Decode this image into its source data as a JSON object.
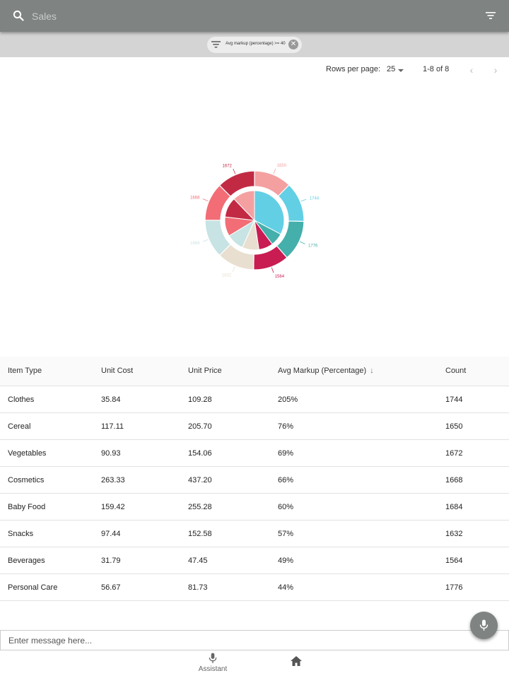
{
  "search": {
    "placeholder": "Sales"
  },
  "filter_chip": {
    "label": "Avg markup (percentage) >= 40"
  },
  "pagination": {
    "rows_per_page_label": "Rows per page:",
    "rows_per_page_value": "25",
    "range_label": "1-8 of 8"
  },
  "table": {
    "columns": [
      "Item Type",
      "Unit Cost",
      "Unit Price",
      "Avg Markup (Percentage)",
      "Count"
    ],
    "rows": [
      [
        "Clothes",
        "35.84",
        "109.28",
        "205%",
        "1744"
      ],
      [
        "Cereal",
        "117.11",
        "205.70",
        "76%",
        "1650"
      ],
      [
        "Vegetables",
        "90.93",
        "154.06",
        "69%",
        "1672"
      ],
      [
        "Cosmetics",
        "263.33",
        "437.20",
        "66%",
        "1668"
      ],
      [
        "Baby Food",
        "159.42",
        "255.28",
        "60%",
        "1684"
      ],
      [
        "Snacks",
        "97.44",
        "152.58",
        "57%",
        "1632"
      ],
      [
        "Beverages",
        "31.79",
        "47.45",
        "49%",
        "1564"
      ],
      [
        "Personal Care",
        "56.67",
        "81.73",
        "44%",
        "1776"
      ]
    ]
  },
  "chart_data": {
    "type": "pie",
    "outer_ring": {
      "categories": [
        "Cereal",
        "Clothes",
        "Personal Care",
        "Beverages",
        "Snacks",
        "Baby Food",
        "Cosmetics",
        "Vegetables"
      ],
      "values": [
        1650,
        1744,
        1776,
        1564,
        1632,
        1684,
        1668,
        1672
      ],
      "labels": [
        "1650",
        "1744",
        "1776",
        "1564",
        "1632",
        "1684",
        "1668",
        "1672"
      ],
      "colors": [
        "#f4a0a1",
        "#62cfe4",
        "#44afab",
        "#c81c52",
        "#e8dfd0",
        "#c7e3e3",
        "#f26d75",
        "#c22a44"
      ]
    },
    "inner_pie": {
      "categories": [
        "Clothes",
        "Personal Care",
        "Beverages",
        "Snacks",
        "Baby Food",
        "Cosmetics",
        "Vegetables",
        "Cereal"
      ],
      "values": [
        205,
        44,
        49,
        57,
        60,
        66,
        69,
        76
      ],
      "colors": [
        "#62cfe4",
        "#44afab",
        "#c81c52",
        "#e8dfd0",
        "#c7e3e3",
        "#f26d75",
        "#c22a44",
        "#f4a0a1"
      ]
    }
  },
  "message": {
    "placeholder": "Enter message here..."
  },
  "bottom_nav": {
    "assistant_label": "Assistant"
  },
  "colors": {
    "app_bar": "#7f8382",
    "chip_bar": "#d4d4d4"
  },
  "icons": [
    "search-icon",
    "filter-icon",
    "close-icon",
    "chevron-left-icon",
    "chevron-right-icon",
    "microphone-icon",
    "home-icon"
  ]
}
